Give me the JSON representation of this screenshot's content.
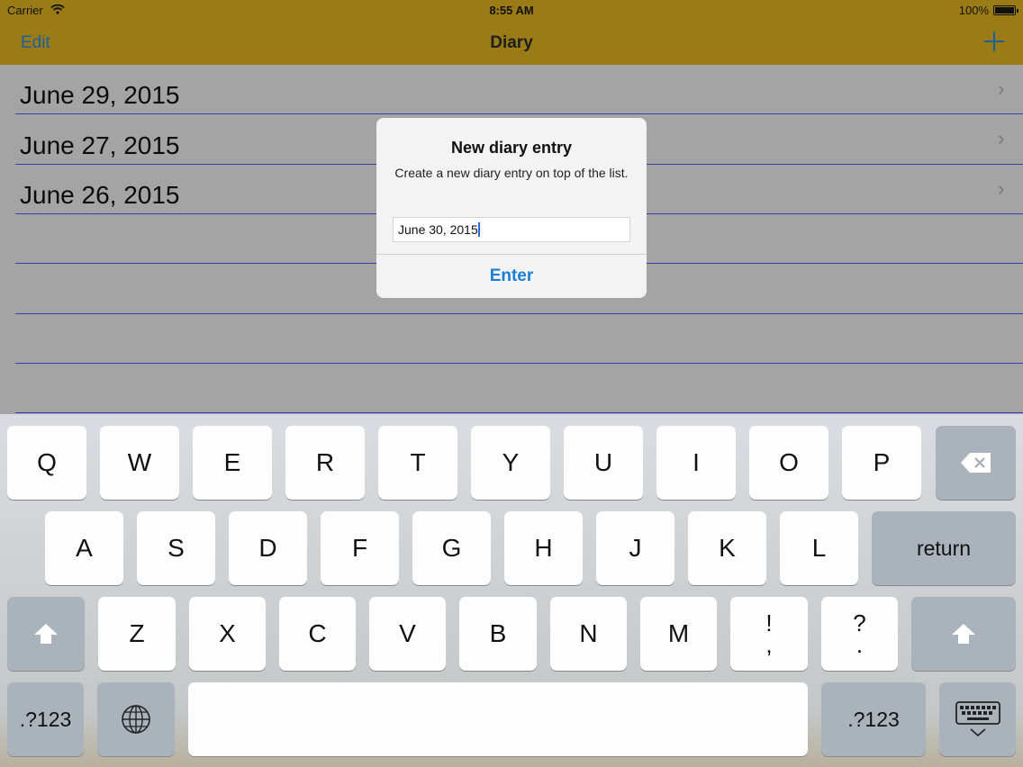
{
  "status": {
    "carrier": "Carrier",
    "time": "8:55 AM",
    "battery": "100%"
  },
  "nav": {
    "edit_label": "Edit",
    "title": "Diary",
    "add_icon": "plus-icon"
  },
  "entries": [
    {
      "label": "June 29, 2015"
    },
    {
      "label": "June 27, 2015"
    },
    {
      "label": "June 26, 2015"
    }
  ],
  "alert": {
    "title": "New diary entry",
    "message": "Create a new diary entry on top of the list.",
    "input_value": "June 30, 2015",
    "button_label": "Enter"
  },
  "keyboard": {
    "row1": [
      "Q",
      "W",
      "E",
      "R",
      "T",
      "Y",
      "U",
      "I",
      "O",
      "P"
    ],
    "row2": [
      "A",
      "S",
      "D",
      "F",
      "G",
      "H",
      "J",
      "K",
      "L"
    ],
    "row3": [
      "Z",
      "X",
      "C",
      "V",
      "B",
      "N",
      "M"
    ],
    "row3_punct": [
      {
        "top": "!",
        "bottom": ","
      },
      {
        "top": "?",
        "bottom": "."
      }
    ],
    "return_label": "return",
    "numbers_label": ".?123",
    "icons": [
      "backspace-icon",
      "shift-icon",
      "globe-icon",
      "keyboard-dismiss-icon"
    ]
  },
  "colors": {
    "nav_bar": "#9a7b15",
    "tint": "#1a5f9e",
    "alert_button": "#1c7fd6",
    "ruled_line": "#3a3eb5"
  }
}
